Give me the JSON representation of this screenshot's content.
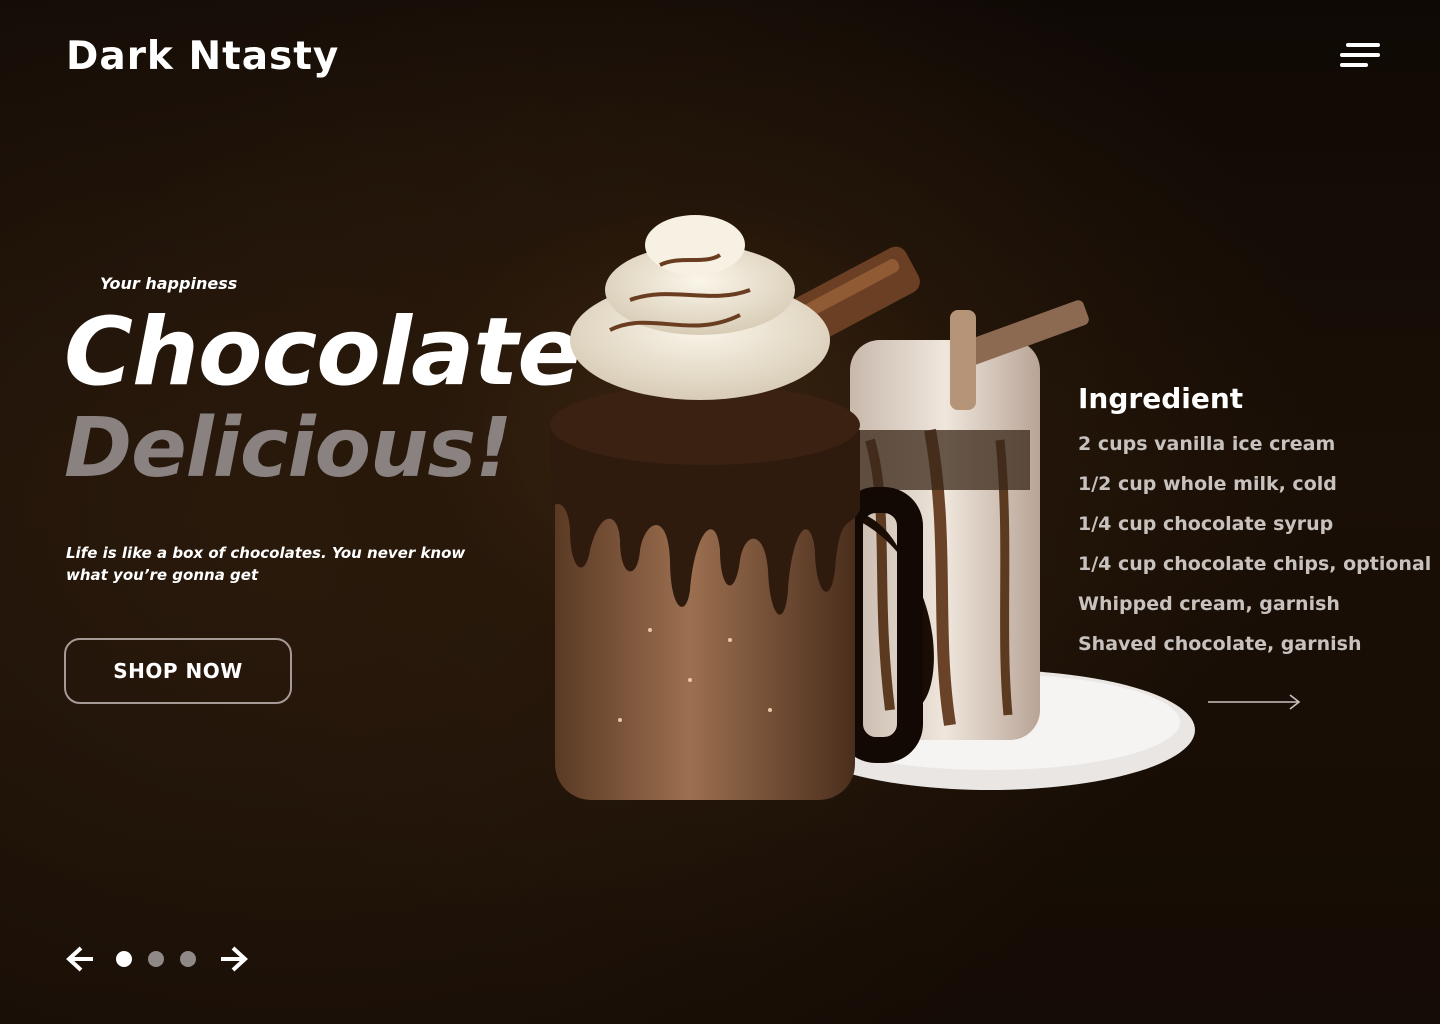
{
  "header": {
    "brand": "Dark Ntasty",
    "menu_icon": "menu-icon"
  },
  "hero": {
    "tagline": "Your  happiness",
    "headline_line1": "Chocolate",
    "headline_line2": "Delicious!",
    "quote": "Life is like a box of chocolates. You never know what you’re gonna get",
    "cta_label": "SHOP NOW"
  },
  "ingredients": {
    "title": "Ingredient",
    "items": [
      "2 cups vanilla ice cream",
      "1/2 cup whole milk, cold",
      "1/4 cup chocolate syrup",
      "1/4 cup chocolate chips, optional",
      "Whipped cream, garnish",
      "Shaved chocolate, garnish"
    ],
    "next_icon": "arrow-right-long-icon"
  },
  "slider": {
    "prev_icon": "arrow-left-icon",
    "next_icon": "arrow-right-icon",
    "slides": 3,
    "active_index": 0
  },
  "colors": {
    "background": "#1a0f06",
    "headline_primary": "#ffffff",
    "headline_secondary": "#8a8280",
    "ingredient_text": "#c8c2bf",
    "button_border": "#a59a95",
    "dot_inactive": "#8f8a88"
  }
}
